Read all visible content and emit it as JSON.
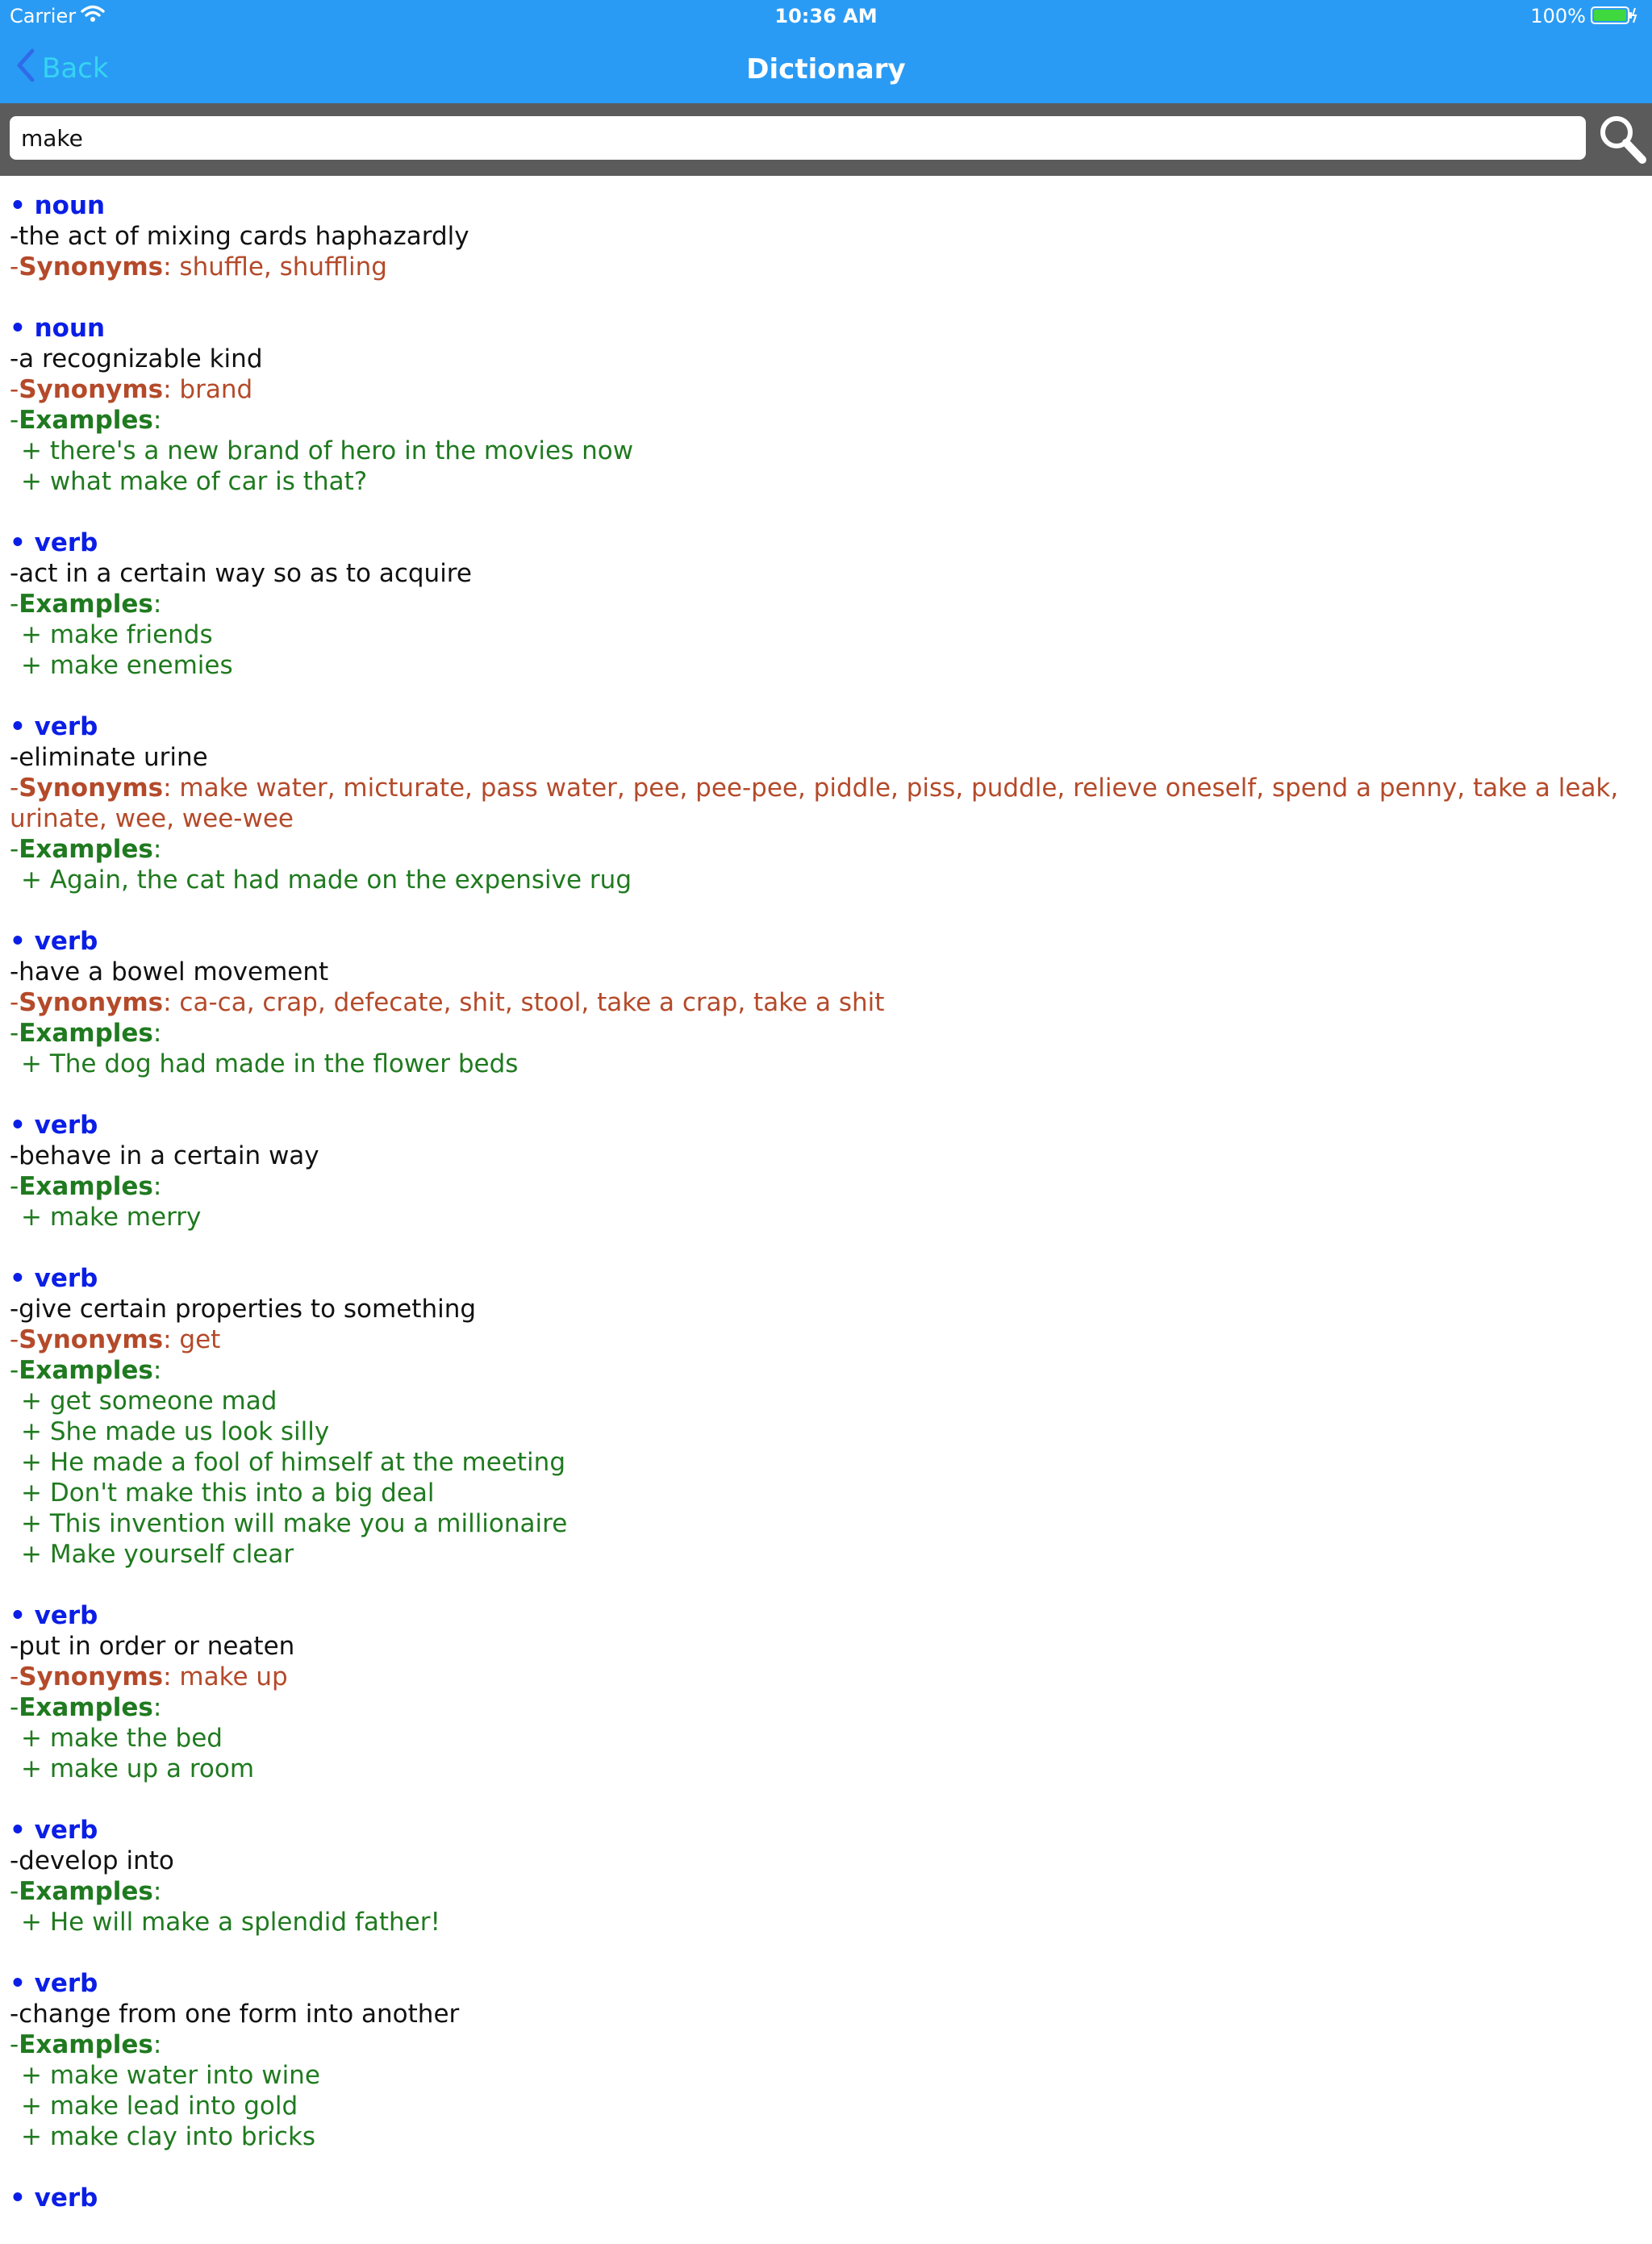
{
  "status": {
    "carrier": "Carrier",
    "time": "10:36 AM",
    "battery": "100%"
  },
  "nav": {
    "back": "Back",
    "title": "Dictionary"
  },
  "search": {
    "value": "make"
  },
  "labels": {
    "synonyms": "Synonyms",
    "examples": "Examples"
  },
  "colors": {
    "nav_bg": "#2a9bf4",
    "pos": "#0a1ee6",
    "synonyms": "#b44a2a",
    "examples": "#1f7a1f"
  },
  "entries": [
    {
      "pos": "noun",
      "definition": "the act of mixing cards haphazardly",
      "synonyms": "shuffle, shuffling",
      "examples": []
    },
    {
      "pos": "noun",
      "definition": "a recognizable kind",
      "synonyms": "brand",
      "examples": [
        "there's a new brand of hero in the movies now",
        "what make of car is that?"
      ]
    },
    {
      "pos": "verb",
      "definition": "act in a certain way so as to acquire",
      "synonyms": "",
      "examples": [
        "make friends",
        "make enemies"
      ]
    },
    {
      "pos": "verb",
      "definition": "eliminate urine",
      "synonyms": "make water, micturate, pass water, pee, pee-pee, piddle, piss, puddle, relieve oneself, spend a penny, take a leak, urinate, wee, wee-wee",
      "examples": [
        "Again, the cat had made on the expensive rug"
      ]
    },
    {
      "pos": "verb",
      "definition": "have a bowel movement",
      "synonyms": "ca-ca, crap, defecate, shit, stool, take a crap, take a shit",
      "examples": [
        "The dog had made in the flower beds"
      ]
    },
    {
      "pos": "verb",
      "definition": "behave in a certain way",
      "synonyms": "",
      "examples": [
        "make merry"
      ]
    },
    {
      "pos": "verb",
      "definition": "give certain properties to something",
      "synonyms": "get",
      "examples": [
        "get someone mad",
        "She made us look silly",
        "He made a fool of himself at the meeting",
        "Don't make this into a big deal",
        "This invention will make you a millionaire",
        "Make yourself clear"
      ]
    },
    {
      "pos": "verb",
      "definition": "put in order or neaten",
      "synonyms": "make up",
      "examples": [
        "make the bed",
        "make up a room"
      ]
    },
    {
      "pos": "verb",
      "definition": "develop into",
      "synonyms": "",
      "examples": [
        "He will make a splendid father!"
      ]
    },
    {
      "pos": "verb",
      "definition": "change from one form into another",
      "synonyms": "",
      "examples": [
        "make water into wine",
        "make lead into gold",
        "make clay into bricks"
      ]
    },
    {
      "pos": "verb",
      "definition": "",
      "synonyms": "",
      "examples": []
    }
  ]
}
